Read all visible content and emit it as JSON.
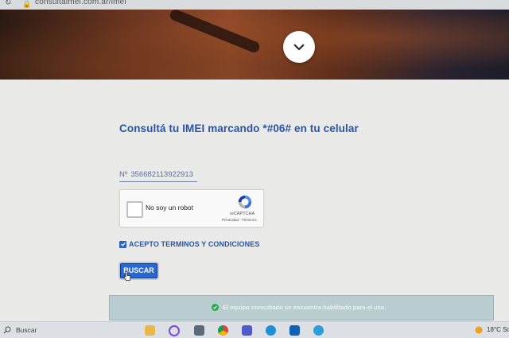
{
  "browser": {
    "url": "consultaimei.com.ar/imei"
  },
  "hero": {
    "toggle_icon": "chevron-down-icon"
  },
  "form": {
    "title": "Consultá tu IMEI marcando *#06# en tu celular",
    "imei_prefix": "Nº",
    "imei_value": "356682113922913",
    "recaptcha": {
      "label": "No soy un robot",
      "brand": "reCAPTCHA",
      "links": "Privacidad - Términos"
    },
    "terms_label": "ACEPTO TERMINOS Y CONDICIONES",
    "terms_checked": true,
    "submit_label": "BUSCAR"
  },
  "result": {
    "message": "El equipo consultado se encuentra habilitado para el uso.",
    "status_color": "#2aa84a"
  },
  "taskbar": {
    "search_label": "Buscar",
    "temperature": "18°C  So",
    "icons": [
      "file-explorer-icon",
      "cortana-icon",
      "calculator-icon",
      "chrome-icon",
      "teams-icon",
      "edge-icon",
      "outlook-icon",
      "edge-dev-icon"
    ]
  },
  "colors": {
    "accent": "#2a55a6",
    "button": "#2a67d2",
    "banner": "#b9cdd0"
  }
}
